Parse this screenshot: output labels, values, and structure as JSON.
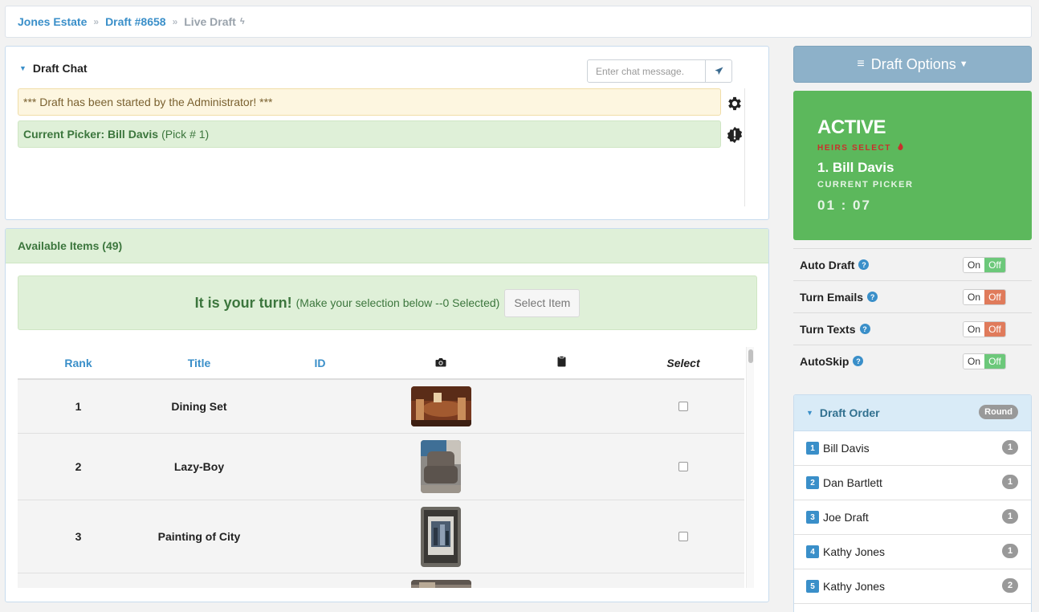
{
  "breadcrumb": {
    "estate": "Jones Estate",
    "separator": "»",
    "draft": "Draft #8658",
    "current": "Live Draft",
    "current_icon": "bolt-icon"
  },
  "chat": {
    "title": "Draft Chat",
    "input_placeholder": "Enter chat message.",
    "send_icon": "paper-plane-icon",
    "system_message": "*** Draft has been started by the Administrator! ***",
    "picker_label": "Current Picker: Bill Davis",
    "picker_note": "(Pick # 1)"
  },
  "items": {
    "header": "Available Items (49)",
    "turn_title": "It is your turn!",
    "turn_note": "(Make your selection below --0 Selected)",
    "select_button": "Select Item",
    "columns": {
      "rank": "Rank",
      "title": "Title",
      "id": "ID",
      "photo_icon": "camera-icon",
      "doc_icon": "clipboard-icon",
      "select": "Select"
    },
    "rows": [
      {
        "rank": "1",
        "title": "Dining Set",
        "id": ""
      },
      {
        "rank": "2",
        "title": "Lazy-Boy",
        "id": ""
      },
      {
        "rank": "3",
        "title": "Painting of City",
        "id": ""
      },
      {
        "rank": "",
        "title": "",
        "id": ""
      }
    ]
  },
  "options": {
    "button_label": "Draft Options"
  },
  "status": {
    "state": "ACTIVE",
    "brand": "HEIRS SELECT",
    "picker": "1. Bill Davis",
    "role": "CURRENT PICKER",
    "timer": "01 : 07"
  },
  "toggles": [
    {
      "label": "Auto Draft",
      "on": "On",
      "off": "Off",
      "state": "off"
    },
    {
      "label": "Turn Emails",
      "on": "On",
      "off": "Off",
      "state": "off"
    },
    {
      "label": "Turn Texts",
      "on": "On",
      "off": "Off",
      "state": "off"
    },
    {
      "label": "AutoSkip",
      "on": "On",
      "off": "Off",
      "state": "off"
    }
  ],
  "order": {
    "title": "Draft Order",
    "round_label": "Round",
    "rows": [
      {
        "num": "1",
        "name": "Bill Davis",
        "round": "1"
      },
      {
        "num": "2",
        "name": "Dan Bartlett",
        "round": "1"
      },
      {
        "num": "3",
        "name": "Joe Draft",
        "round": "1"
      },
      {
        "num": "4",
        "name": "Kathy Jones",
        "round": "1"
      },
      {
        "num": "5",
        "name": "Kathy Jones",
        "round": "2"
      }
    ]
  },
  "colors": {
    "link": "#3a8fc9",
    "success": "#5cb85c",
    "off_green": "#6cc87a",
    "off_red": "#e07b5b"
  }
}
